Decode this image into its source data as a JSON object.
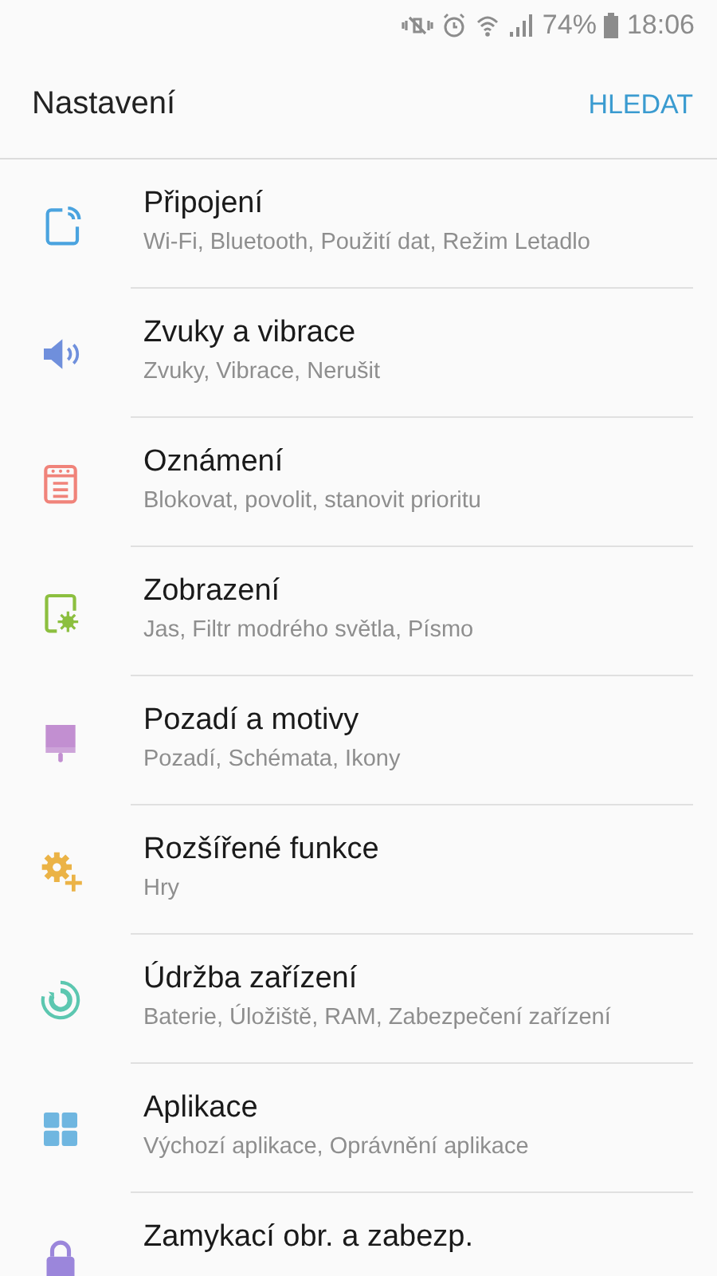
{
  "status_bar": {
    "battery_percent": "74%",
    "time": "18:06"
  },
  "header": {
    "title": "Nastavení",
    "action": "HLEDAT"
  },
  "items": [
    {
      "kind": "connections",
      "color": "#4aa3df",
      "title": "Připojení",
      "subtitle": "Wi-Fi, Bluetooth, Použití dat, Režim Letadlo"
    },
    {
      "kind": "sound",
      "color": "#6f8fdc",
      "title": "Zvuky a vibrace",
      "subtitle": "Zvuky, Vibrace, Nerušit"
    },
    {
      "kind": "notifications",
      "color": "#f0837a",
      "title": "Oznámení",
      "subtitle": "Blokovat, povolit, stanovit prioritu"
    },
    {
      "kind": "display",
      "color": "#8cbf3f",
      "title": "Zobrazení",
      "subtitle": "Jas, Filtr modrého světla, Písmo"
    },
    {
      "kind": "wallpaper",
      "color": "#c28fd1",
      "title": "Pozadí a motivy",
      "subtitle": "Pozadí, Schémata, Ikony"
    },
    {
      "kind": "advanced",
      "color": "#ebb346",
      "title": "Rozšířené funkce",
      "subtitle": "Hry"
    },
    {
      "kind": "maintenance",
      "color": "#5cc7b0",
      "title": "Údržba zařízení",
      "subtitle": "Baterie, Úložiště, RAM, Zabezpečení zařízení"
    },
    {
      "kind": "apps",
      "color": "#6fb6e0",
      "title": "Aplikace",
      "subtitle": "Výchozí aplikace, Oprávnění aplikace"
    },
    {
      "kind": "lock",
      "color": "#9b86db",
      "title": "Zamykací obr. a zabezp."
    }
  ]
}
